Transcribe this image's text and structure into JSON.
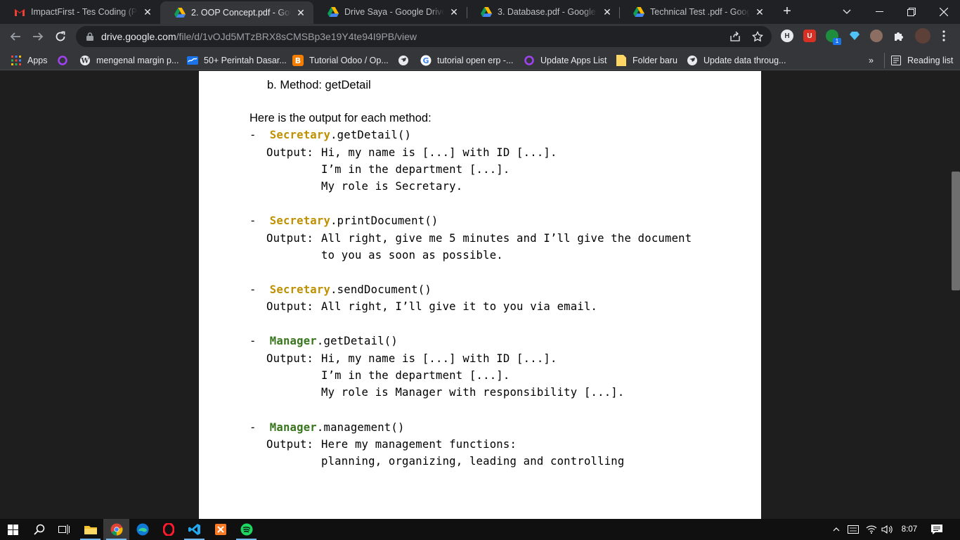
{
  "tabs": [
    {
      "title": "ImpactFirst - Tes Coding (Pen",
      "icon": "gmail-icon",
      "active": false
    },
    {
      "title": "2. OOP Concept.pdf - Google",
      "icon": "google-drive-icon",
      "active": true
    },
    {
      "title": "Drive Saya - Google Drive",
      "icon": "google-drive-icon",
      "active": false
    },
    {
      "title": "3. Database.pdf - Google Dri",
      "icon": "google-drive-icon",
      "active": false
    },
    {
      "title": "Technical Test .pdf - Google D",
      "icon": "google-drive-icon",
      "active": false
    }
  ],
  "address_bar": {
    "host": "drive.google.com",
    "path": "/file/d/1vOJd5MTzBRX8sCMSBp3e19Y4te94I9PB/view"
  },
  "bookmarks": {
    "apps_label": "Apps",
    "items": [
      {
        "label": "",
        "icon": "circle-icon"
      },
      {
        "label": "mengenal margin p...",
        "icon": "wordpress-icon"
      },
      {
        "label": "50+ Perintah Dasar...",
        "icon": "wave-icon"
      },
      {
        "label": "Tutorial Odoo / Op...",
        "icon": "blogger-icon"
      },
      {
        "label": "",
        "icon": "globe-icon"
      },
      {
        "label": "tutorial open erp -...",
        "icon": "google-icon"
      },
      {
        "label": "Update Apps List",
        "icon": "circle-icon"
      },
      {
        "label": "Folder baru",
        "icon": "folder-icon"
      },
      {
        "label": "Update data throug...",
        "icon": "globe-icon"
      }
    ],
    "overflow": "»",
    "reading_list": "Reading list"
  },
  "document": {
    "item_b": "b.  Method: getDetail",
    "intro": "Here is the output for each method:",
    "methods": [
      {
        "bullet": "-",
        "class_name": "Secretary",
        "class_type": "secretary",
        "method": ".getDetail()",
        "output_label": "Output:",
        "output_lines": [
          "Hi, my name is [...] with ID [...].",
          "I’m in the department [...].",
          "My role is Secretary."
        ]
      },
      {
        "bullet": "-",
        "class_name": "Secretary",
        "class_type": "secretary",
        "method": ".printDocument()",
        "output_label": "Output:",
        "output_lines": [
          "All right, give me 5 minutes and I’ll give the document",
          "to you as soon as possible."
        ]
      },
      {
        "bullet": "-",
        "class_name": "Secretary",
        "class_type": "secretary",
        "method": ".sendDocument()",
        "output_label": "Output:",
        "output_lines": [
          "All right, I’ll give it to you via email."
        ]
      },
      {
        "bullet": "-",
        "class_name": "Manager",
        "class_type": "manager",
        "method": ".getDetail()",
        "output_label": "Output:",
        "output_lines": [
          "Hi, my name is [...] with ID [...].",
          "I’m in the department [...].",
          "My role is Manager with responsibility [...]."
        ]
      },
      {
        "bullet": "-",
        "class_name": "Manager",
        "class_type": "manager",
        "method": ".management()",
        "output_label": "Output:",
        "output_lines": [
          "Here my management functions:",
          "planning, organizing, leading and controlling"
        ]
      }
    ]
  },
  "taskbar": {
    "apps": [
      "windows-start-icon",
      "search-icon",
      "task-view-icon",
      "file-explorer-icon",
      "chrome-icon",
      "edge-icon",
      "opera-icon",
      "vscode-icon",
      "xampp-icon",
      "spotify-icon"
    ],
    "time": "8:07"
  },
  "colors": {
    "secretary": "#bf9000",
    "manager": "#38761d"
  }
}
